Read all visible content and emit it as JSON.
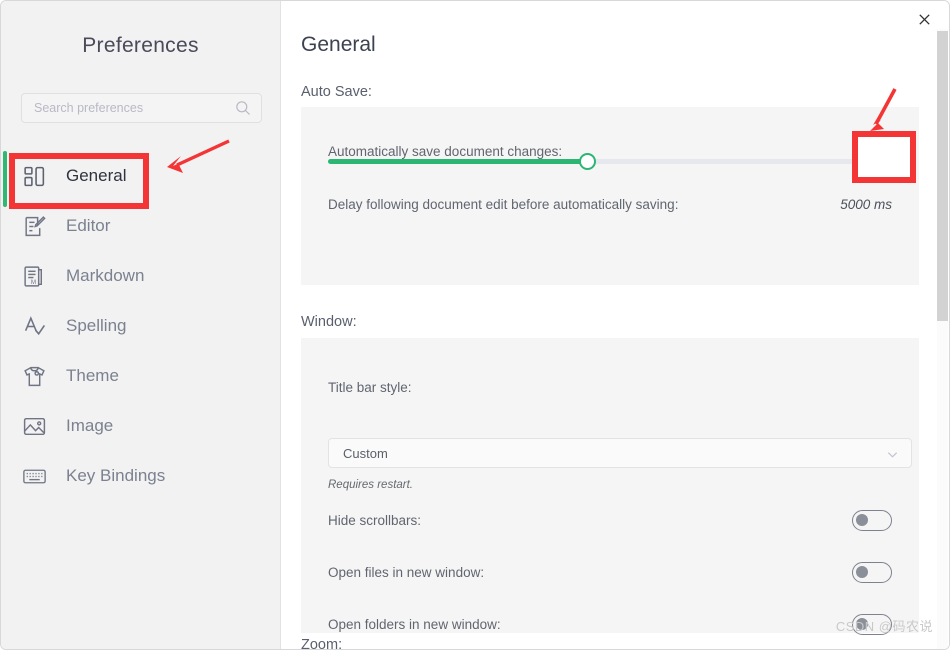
{
  "window": {
    "close_label": "✕"
  },
  "sidebar": {
    "title": "Preferences",
    "search": {
      "placeholder": "Search preferences",
      "value": "",
      "icon": "search-icon"
    },
    "active_item": "General",
    "items": [
      {
        "label": "General",
        "icon": "layout-blocks-icon"
      },
      {
        "label": "Editor",
        "icon": "document-edit-icon"
      },
      {
        "label": "Markdown",
        "icon": "markdown-document-icon"
      },
      {
        "label": "Spelling",
        "icon": "spell-check-icon"
      },
      {
        "label": "Theme",
        "icon": "t-shirt-icon"
      },
      {
        "label": "Image",
        "icon": "image-picture-icon"
      },
      {
        "label": "Key Bindings",
        "icon": "keyboard-icon"
      }
    ]
  },
  "main": {
    "page_title": "General",
    "sections": [
      {
        "label": "Auto Save:",
        "rows": [
          {
            "label": "Automatically save document changes:",
            "control": "toggle",
            "state": "off"
          },
          {
            "label": "Delay following document edit before automatically saving:",
            "value": "5000 ms",
            "control": "slider",
            "slider": {
              "percent": 44.5,
              "min_label": "",
              "max_label": ""
            }
          }
        ]
      },
      {
        "label": "Window:",
        "rows": [
          {
            "label": "Title bar style:",
            "control": "select",
            "selected": "Custom",
            "note": "Requires restart."
          },
          {
            "label": "Hide scrollbars:",
            "control": "toggle",
            "state": "off"
          },
          {
            "label": "Open files in new window:",
            "control": "toggle",
            "state": "off"
          },
          {
            "label": "Open folders in new window:",
            "control": "toggle",
            "state": "off"
          }
        ]
      },
      {
        "label": "Zoom:",
        "rows": []
      }
    ]
  },
  "annotations": {
    "highlight_color": "#f43535",
    "general_highlight": "General",
    "toggle_highlight": "Automatically save document changes toggle"
  },
  "watermark": "CSDN @码农说",
  "colors": {
    "accent_green": "#2bb673",
    "annotation_red": "#f43535",
    "sidebar_bg": "#f2f2f2",
    "panel_bg": "#f5f5f5"
  }
}
